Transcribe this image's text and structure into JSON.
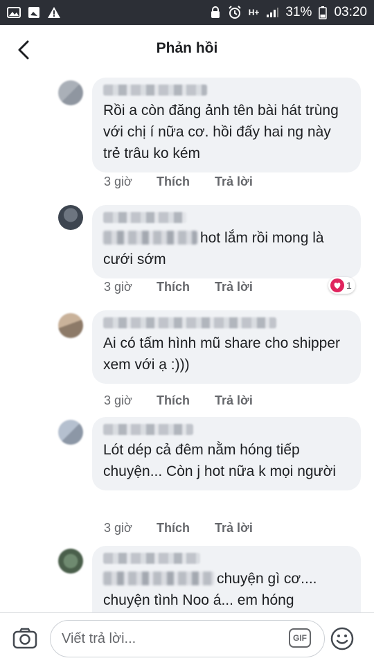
{
  "status_bar": {
    "battery": "31%",
    "time": "03:20",
    "network": "H+"
  },
  "header": {
    "title": "Phản hồi",
    "back_icon": "chevron-left-icon"
  },
  "comments": [
    {
      "text": "Rồi a còn đăng ảnh tên bài hát trùng với chị í nữa cơ. hồi đấy hai ng này trẻ trâu ko kém",
      "time": "3 giờ",
      "like_label": "Thích",
      "reply_label": "Trả lời"
    },
    {
      "text": "hot lắm rồi mong là cưới sớm",
      "time": "3 giờ",
      "like_label": "Thích",
      "reply_label": "Trả lời",
      "reaction_count": "1",
      "reaction_icon": "heart-icon"
    },
    {
      "text": "Ai có tấm hình mũ share cho shipper xem với ạ :)))",
      "time": "3 giờ",
      "like_label": "Thích",
      "reply_label": "Trả lời"
    },
    {
      "text": "Lót dép cả đêm nằm hóng tiếp chuyện... Còn j hot nữa k mọi người",
      "time": "3 giờ",
      "like_label": "Thích",
      "reply_label": "Trả lời"
    },
    {
      "text_line1": "chuyện gì cơ....",
      "text_line2": "chuyện tình Noo á... em hóng"
    }
  ],
  "composer": {
    "placeholder": "Viết trả lời...",
    "gif_label": "GIF",
    "camera_icon": "camera-icon",
    "emoji_icon": "smiley-icon"
  },
  "colors": {
    "status_bar_bg": "#2c2f36",
    "bubble_bg": "#f0f2f5",
    "meta_text": "#65676b",
    "heart": "#e0245e"
  }
}
